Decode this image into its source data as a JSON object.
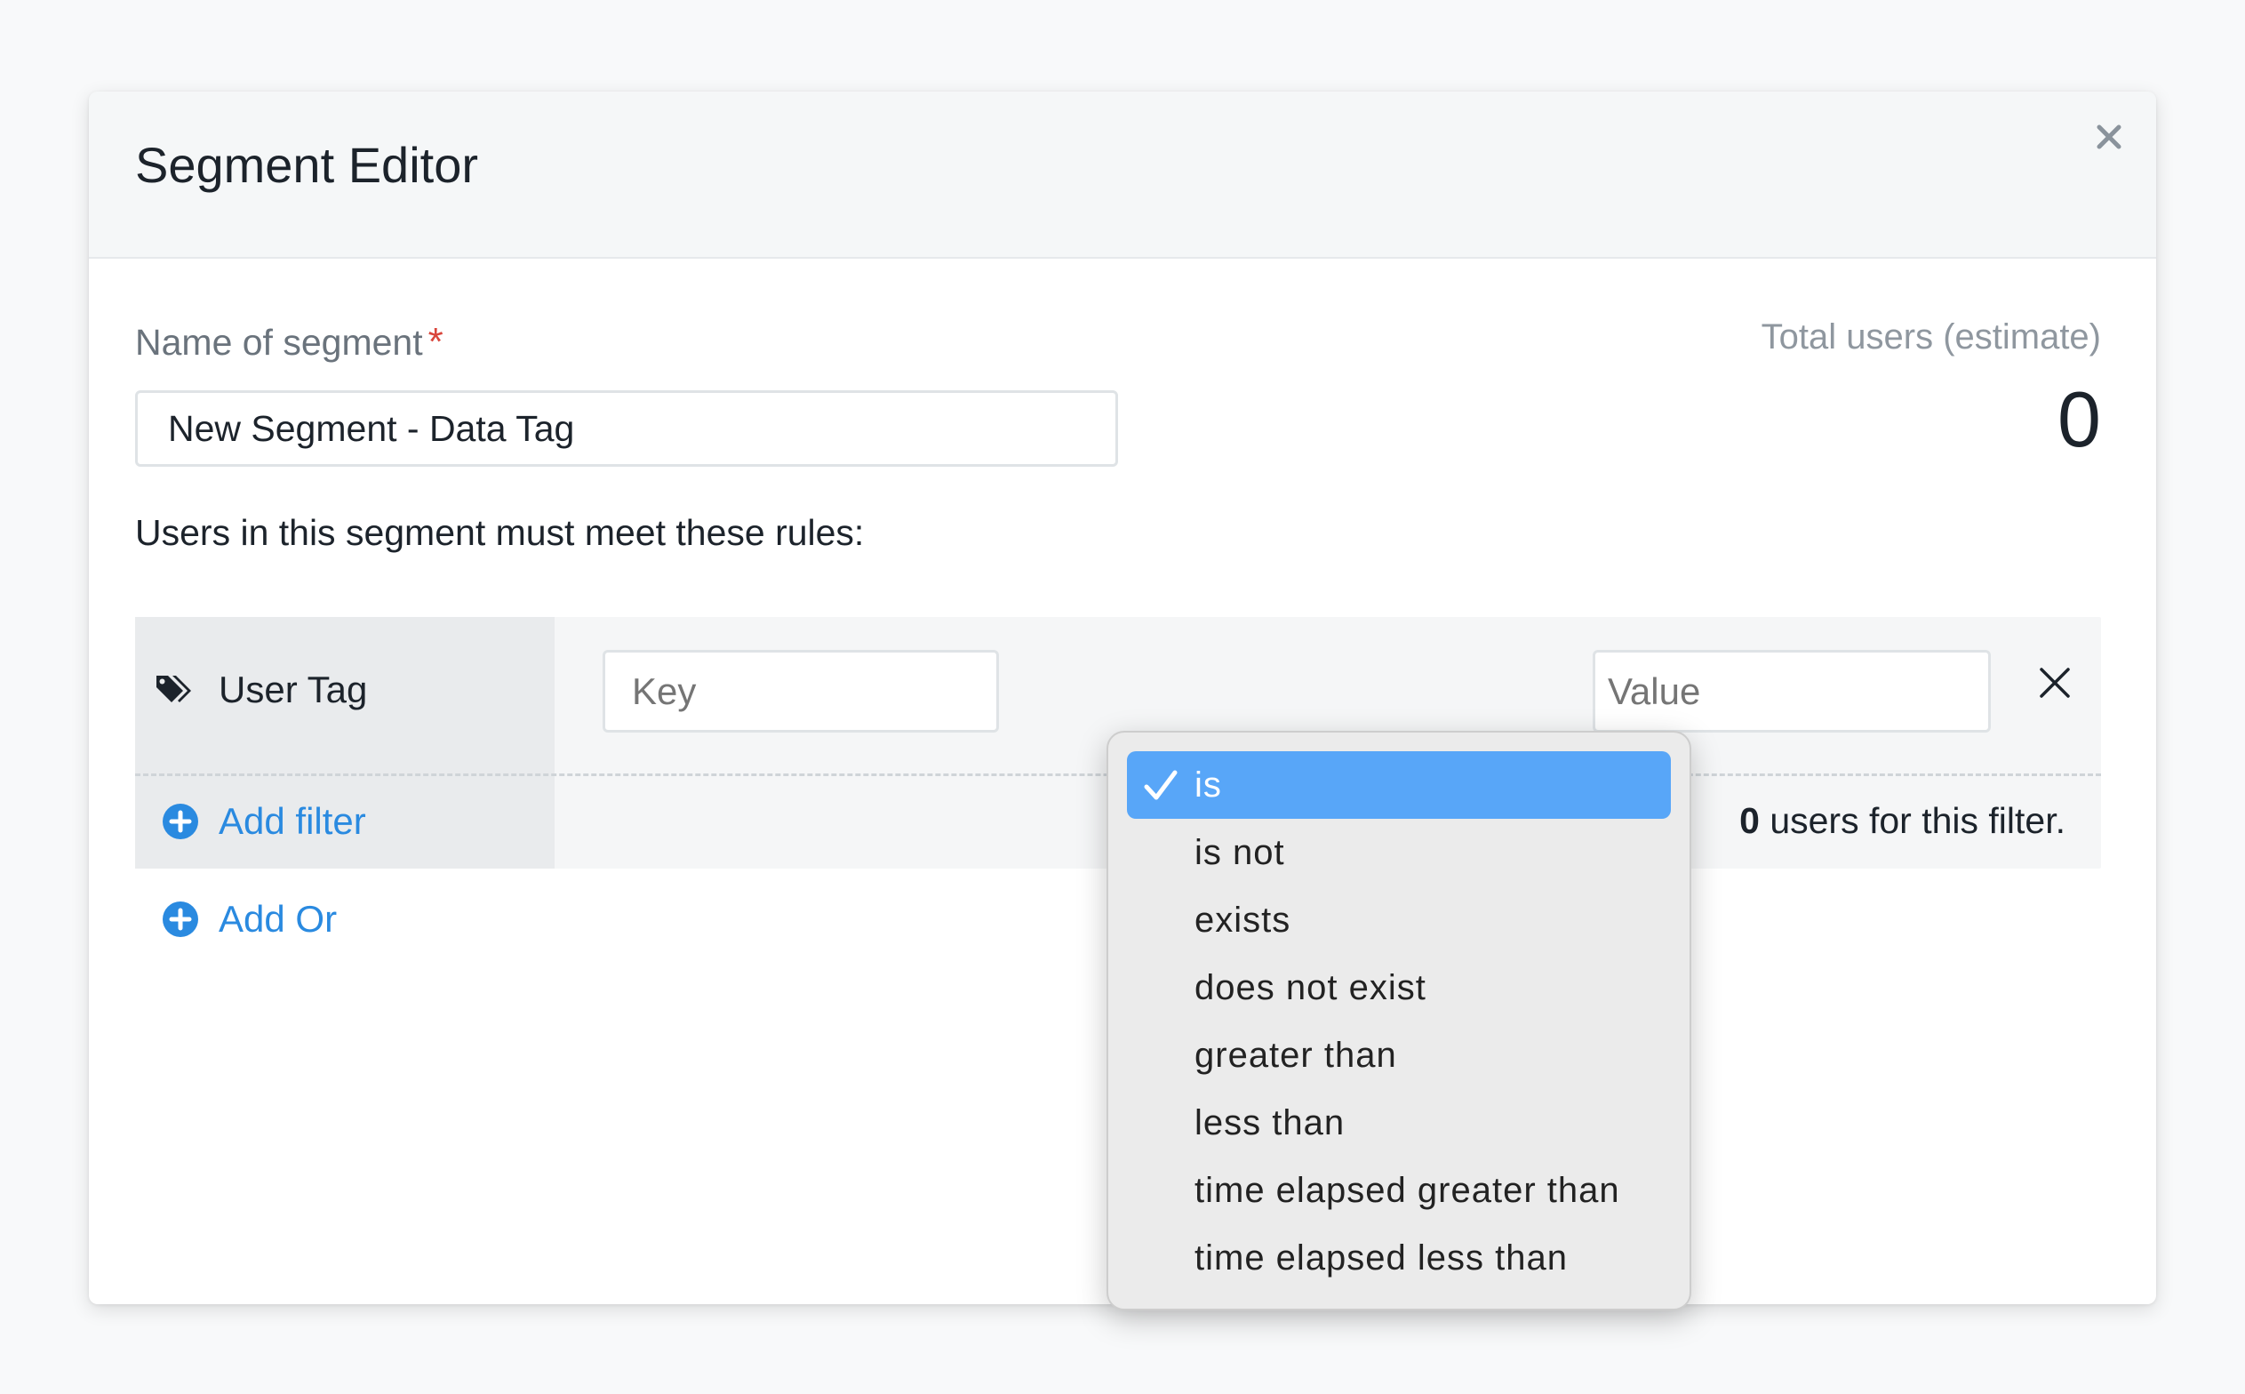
{
  "modal": {
    "title": "Segment Editor",
    "close_icon": "close-icon"
  },
  "form": {
    "name_label": "Name of segment",
    "required_marker": "*",
    "name_value": "New Segment - Data Tag",
    "total_label": "Total users (estimate)",
    "total_value": "0",
    "rules_text": "Users in this segment must meet these rules:"
  },
  "rule": {
    "type_icon": "tag-icon",
    "type_label": "User Tag",
    "key_placeholder": "Key",
    "value_placeholder": "Value",
    "add_filter_label": "Add filter",
    "count_value": "0",
    "count_suffix": " users for this filter."
  },
  "add_or_label": "Add Or",
  "operator_dropdown": {
    "selected": "is",
    "options": [
      "is",
      "is not",
      "exists",
      "does not exist",
      "greater than",
      "less than",
      "time elapsed greater than",
      "time elapsed less than"
    ]
  },
  "colors": {
    "accent": "#2a8ae0",
    "selected_option": "#58a6f8",
    "required": "#d9453b"
  }
}
